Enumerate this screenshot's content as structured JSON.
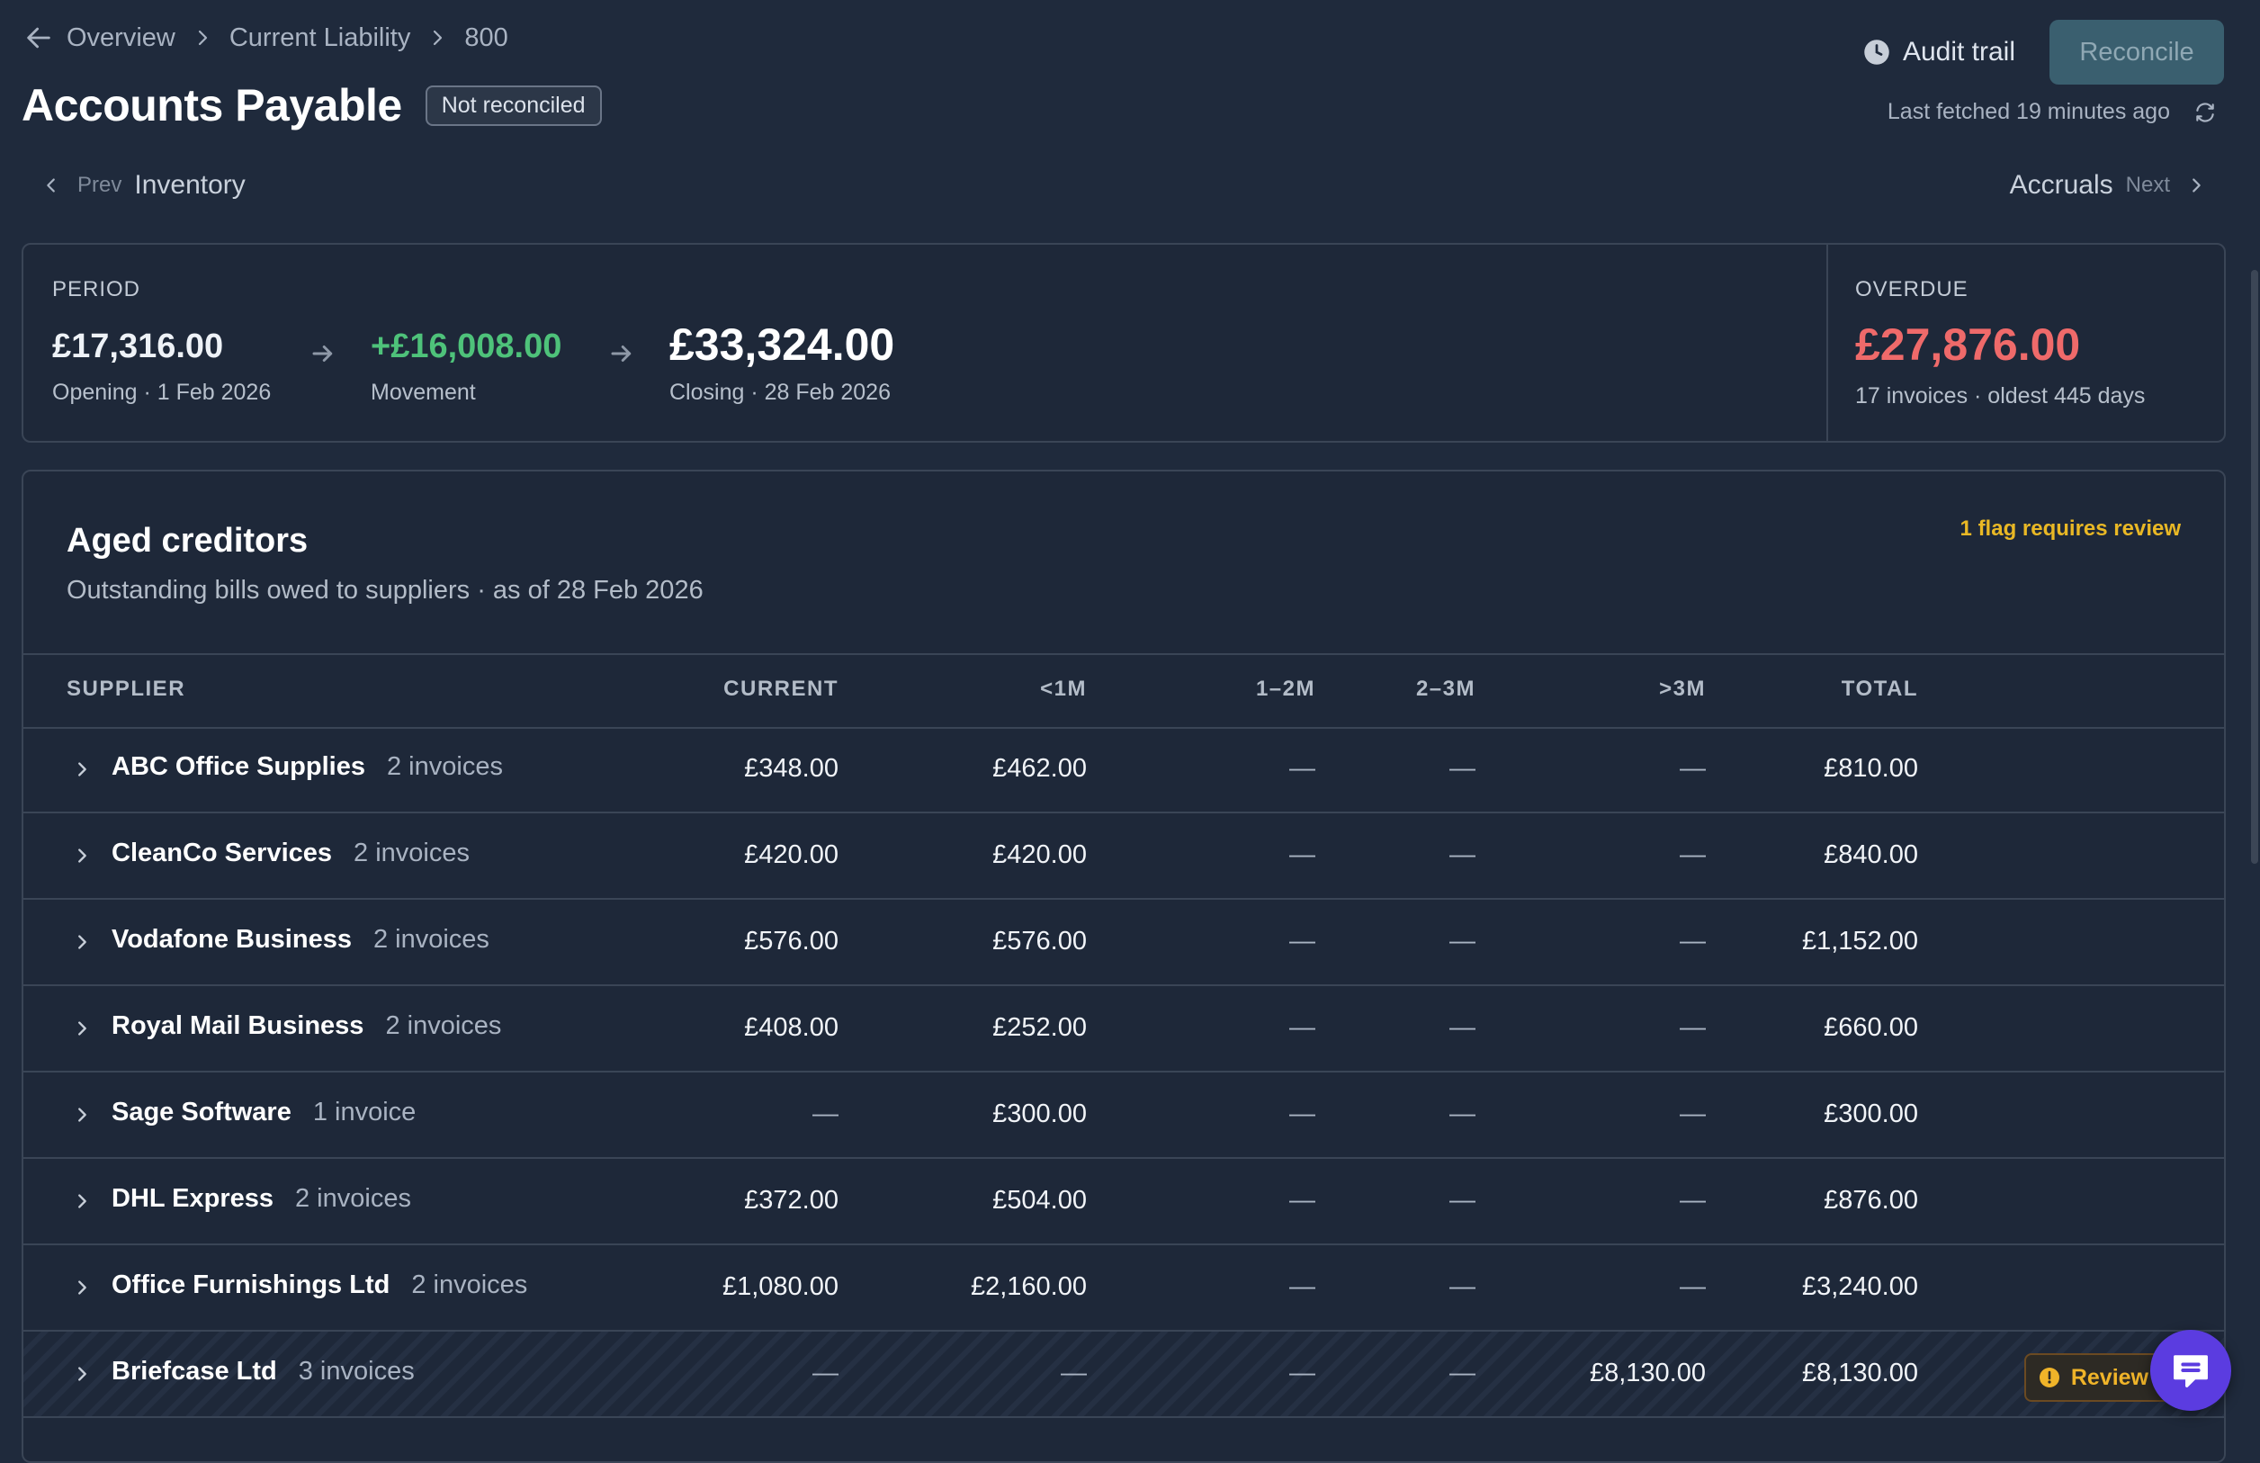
{
  "breadcrumb": {
    "items": [
      "Overview",
      "Current Liability",
      "800"
    ]
  },
  "page": {
    "title": "Accounts Payable",
    "status": "Not reconciled"
  },
  "actions": {
    "audit_label": "Audit trail",
    "reconcile_label": "Reconcile",
    "last_fetched": "Last fetched 19 minutes ago"
  },
  "nav": {
    "prev_small": "Prev",
    "prev_target": "Inventory",
    "next_target": "Accruals",
    "next_small": "Next"
  },
  "period": {
    "label": "PERIOD",
    "opening_amount": "£17,316.00",
    "opening_caption": "Opening · 1 Feb 2026",
    "movement_amount": "+£16,008.00",
    "movement_caption": "Movement",
    "closing_amount": "£33,324.00",
    "closing_caption": "Closing · 28 Feb 2026"
  },
  "overdue": {
    "label": "OVERDUE",
    "amount": "£27,876.00",
    "caption": "17 invoices · oldest 445 days"
  },
  "aged": {
    "title": "Aged creditors",
    "subtitle": "Outstanding bills owed to suppliers · as of 28 Feb 2026",
    "flag_note": "1 flag requires review",
    "columns": [
      "SUPPLIER",
      "CURRENT",
      "<1M",
      "1–2M",
      "2–3M",
      ">3M",
      "TOTAL"
    ],
    "rows": [
      {
        "supplier": "ABC Office Supplies",
        "count": "2 invoices",
        "current": "£348.00",
        "m1": "£462.00",
        "m12": "—",
        "m23": "—",
        "m3": "—",
        "total": "£810.00"
      },
      {
        "supplier": "CleanCo Services",
        "count": "2 invoices",
        "current": "£420.00",
        "m1": "£420.00",
        "m12": "—",
        "m23": "—",
        "m3": "—",
        "total": "£840.00"
      },
      {
        "supplier": "Vodafone Business",
        "count": "2 invoices",
        "current": "£576.00",
        "m1": "£576.00",
        "m12": "—",
        "m23": "—",
        "m3": "—",
        "total": "£1,152.00"
      },
      {
        "supplier": "Royal Mail Business",
        "count": "2 invoices",
        "current": "£408.00",
        "m1": "£252.00",
        "m12": "—",
        "m23": "—",
        "m3": "—",
        "total": "£660.00"
      },
      {
        "supplier": "Sage Software",
        "count": "1 invoice",
        "current": "—",
        "m1": "£300.00",
        "m12": "—",
        "m23": "—",
        "m3": "—",
        "total": "£300.00"
      },
      {
        "supplier": "DHL Express",
        "count": "2 invoices",
        "current": "£372.00",
        "m1": "£504.00",
        "m12": "—",
        "m23": "—",
        "m3": "—",
        "total": "£876.00"
      },
      {
        "supplier": "Office Furnishings Ltd",
        "count": "2 invoices",
        "current": "£1,080.00",
        "m1": "£2,160.00",
        "m12": "—",
        "m23": "—",
        "m3": "—",
        "total": "£3,240.00"
      },
      {
        "supplier": "Briefcase Ltd",
        "count": "3 invoices",
        "current": "—",
        "m1": "—",
        "m12": "—",
        "m23": "—",
        "m3": "£8,130.00",
        "total": "£8,130.00",
        "review_label": "Review"
      }
    ]
  },
  "colors": {
    "background": "#1f2a3c",
    "positive": "#4ec27a",
    "overdue": "#ef6a6a",
    "warning": "#e9b825",
    "chat": "#5b3ce0"
  },
  "icons": [
    "arrow-left-icon",
    "chevron-right-icon",
    "clock-icon",
    "refresh-icon",
    "chevron-left-icon",
    "arrow-right-icon",
    "alert-icon",
    "chat-icon"
  ]
}
